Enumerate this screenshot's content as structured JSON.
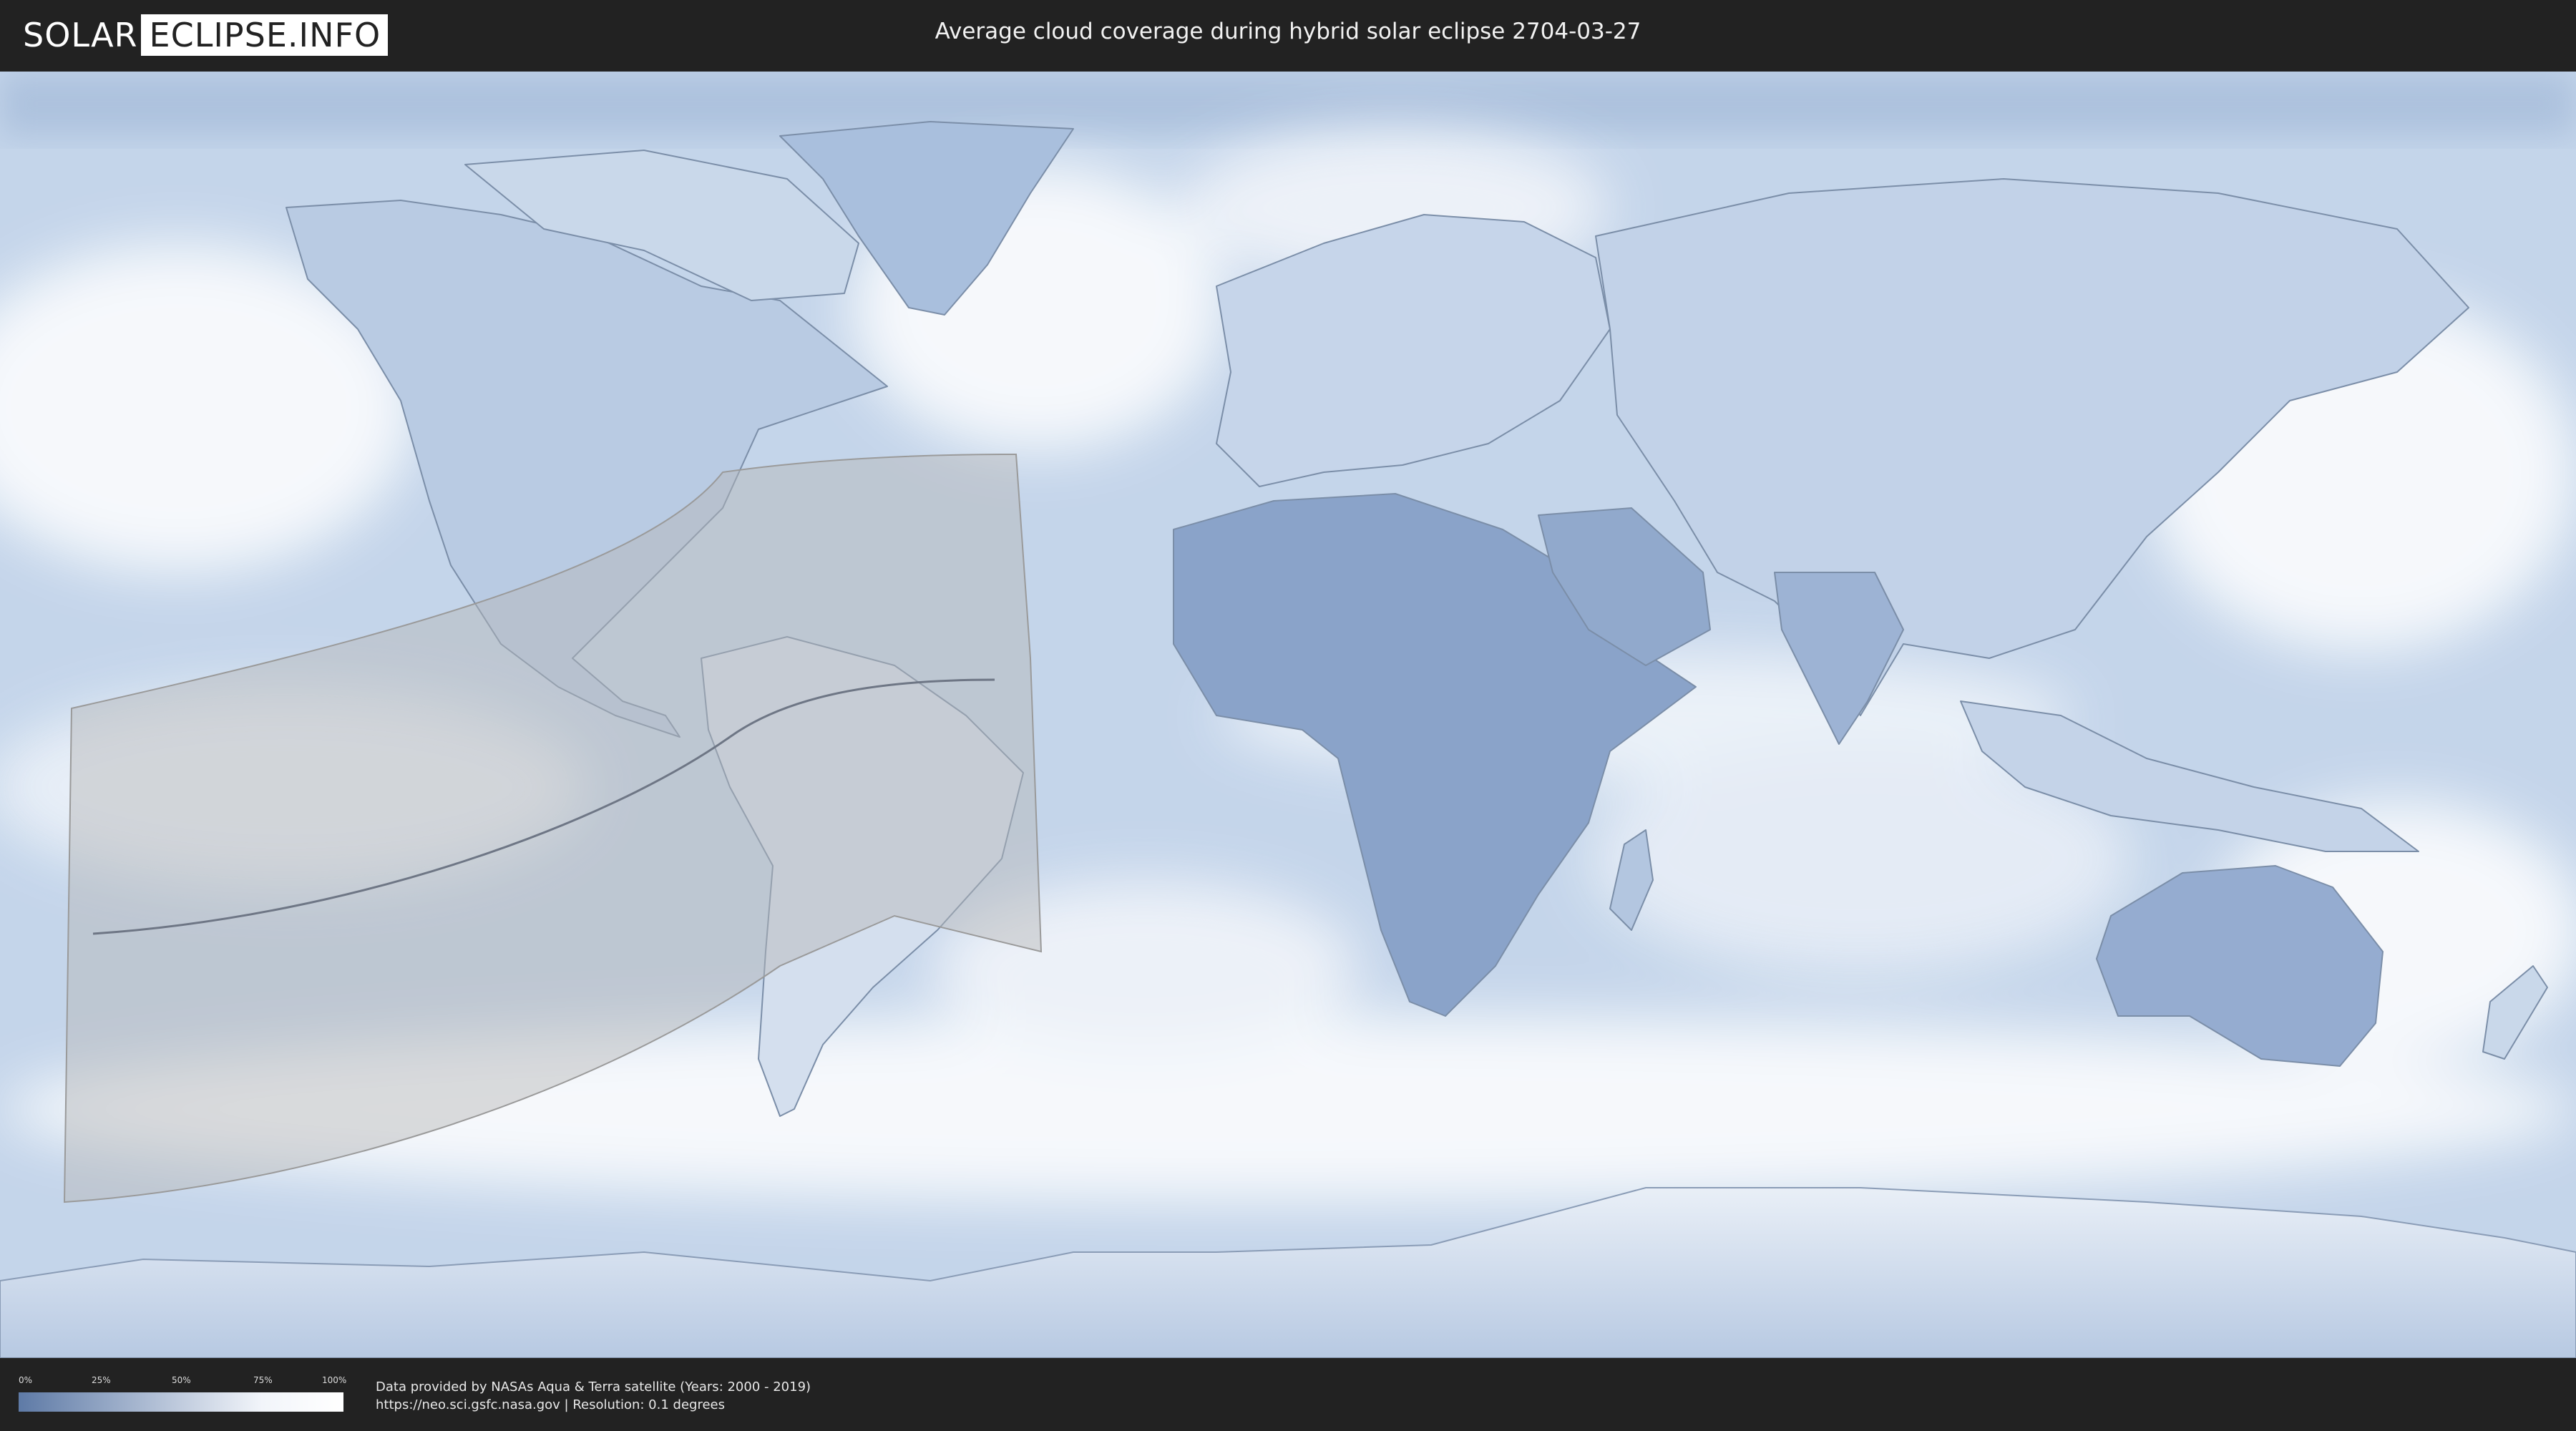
{
  "header": {
    "logo_left": "SOLAR",
    "logo_right": "ECLIPSE.INFO",
    "title": "Average cloud coverage during hybrid solar eclipse 2704-03-27"
  },
  "legend": {
    "ticks": [
      "0%",
      "25%",
      "50%",
      "75%",
      "100%"
    ],
    "colors": {
      "low": "#5e7aa6",
      "high": "#ffffff"
    }
  },
  "footer": {
    "credit_line1": "Data provided by NASAs Aqua & Terra satellite (Years: 2000 - 2019)",
    "credit_line2": "https://neo.sci.gsfc.nasa.gov | Resolution: 0.1 degrees"
  },
  "map": {
    "projection": "equirectangular",
    "ocean_color": "#c9d8ea",
    "cloud_color": "#ffffff",
    "land_outline_color": "#6b7f99",
    "eclipse_overlay_color": "#bdbdbd"
  }
}
